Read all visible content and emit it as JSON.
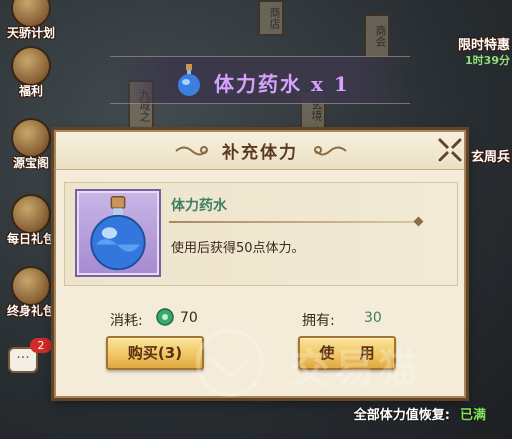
{
  "left_menu": [
    "天骄计划",
    "福利",
    "源宝阁",
    "每日礼包",
    "终身礼包"
  ],
  "right_menu": {
    "label1": "限时特惠",
    "timer": "1时39分",
    "label2": "玄周兵"
  },
  "scene_signs": [
    "商店",
    "商会",
    "九域之",
    "玄境"
  ],
  "chat": {
    "badge": "2"
  },
  "banner": {
    "text": "体力药水 x 1"
  },
  "dialog": {
    "title": "补充体力",
    "item": {
      "name": "体力药水",
      "description": "使用后获得50点体力。"
    },
    "cost": {
      "label": "消耗:",
      "value": "70",
      "icon": "jade-icon"
    },
    "owned": {
      "label": "拥有:",
      "value": "30"
    },
    "buttons": {
      "buy": "购买(3)",
      "use": "使 用"
    }
  },
  "recovery": {
    "label": "全部体力值恢复:",
    "status": "已满"
  },
  "watermark": {
    "text": "交易猫"
  },
  "colors": {
    "item_name": "#3f7f63",
    "banner_text": "#d6a3ff",
    "full_status": "#7fe25a",
    "button_gold": "#f0c766"
  }
}
